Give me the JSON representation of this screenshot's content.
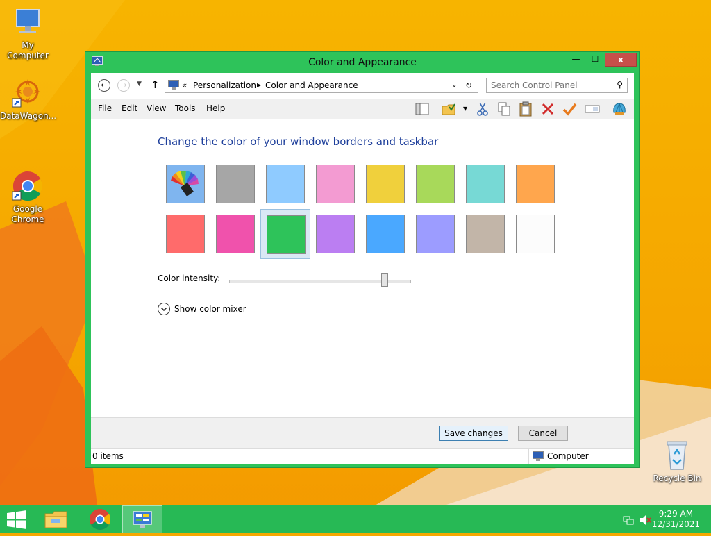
{
  "desktop": {
    "icons": [
      {
        "label": "My Computer"
      },
      {
        "label": "DataWagon..."
      },
      {
        "label": "Google\nChrome"
      },
      {
        "label": "Recycle Bin"
      }
    ]
  },
  "window": {
    "title": "Color and Appearance",
    "caption_buttons": {
      "minimize": "—",
      "maximize": "☐",
      "close": "x"
    }
  },
  "address": {
    "chevrons": "«",
    "crumbs": [
      "Personalization",
      "Color and Appearance"
    ],
    "search_placeholder": "Search Control Panel"
  },
  "menu": [
    "File",
    "Edit",
    "View",
    "Tools",
    "Help"
  ],
  "toolbar_icons": [
    "layout-icon",
    "folder-options-icon",
    "cut-icon",
    "copy-icon",
    "paste-icon",
    "delete-icon",
    "properties-icon",
    "rename-icon",
    "shell-icon"
  ],
  "content": {
    "heading": "Change the color of your window borders and taskbar",
    "swatches": [
      {
        "id": "automatic",
        "color": "auto"
      },
      {
        "id": "gray",
        "color": "#a6a6a6"
      },
      {
        "id": "sky-blue",
        "color": "#8fcbff"
      },
      {
        "id": "pink",
        "color": "#f39bd2"
      },
      {
        "id": "yellow",
        "color": "#f0d03c"
      },
      {
        "id": "lime",
        "color": "#a8d95a"
      },
      {
        "id": "teal",
        "color": "#77d9d5"
      },
      {
        "id": "orange",
        "color": "#ffa64d"
      },
      {
        "id": "red",
        "color": "#ff6b6b"
      },
      {
        "id": "magenta",
        "color": "#f052ac"
      },
      {
        "id": "green",
        "color": "#2ec35a",
        "selected": true
      },
      {
        "id": "violet",
        "color": "#bb7ef2"
      },
      {
        "id": "blue",
        "color": "#4aa8ff"
      },
      {
        "id": "periwinkle",
        "color": "#9c9cff"
      },
      {
        "id": "taupe",
        "color": "#c2b5a8"
      },
      {
        "id": "white",
        "color": "#fcfcfc"
      }
    ],
    "intensity_label": "Color intensity:",
    "intensity_value": 0.86,
    "mixer_label": "Show color mixer"
  },
  "footer": {
    "save": "Save changes",
    "cancel": "Cancel"
  },
  "status": {
    "items": "0 items",
    "location": "Computer"
  },
  "taskbar": {
    "apps": [
      "start-icon",
      "file-explorer-icon",
      "chrome-icon",
      "control-panel-icon"
    ],
    "time": "9:29 AM",
    "date": "12/31/2021"
  },
  "colors": {
    "accent": "#2ec35a",
    "close": "#c7504a",
    "heading": "#1e3f9b"
  }
}
